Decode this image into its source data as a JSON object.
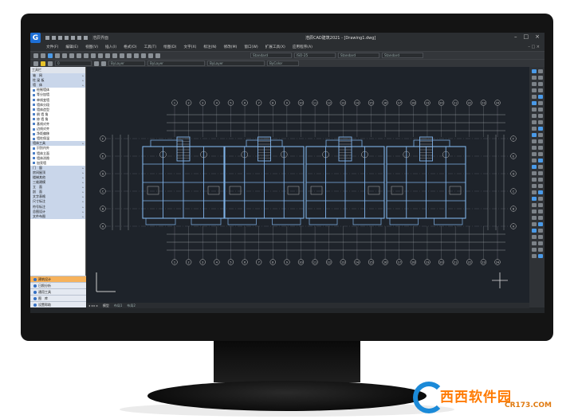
{
  "app": {
    "title": "浩辰CAD建筑2021 - [Drawing1.dwg]",
    "workspace": "浩辰界面"
  },
  "menubar": {
    "items": [
      "文件(F)",
      "编辑(E)",
      "视图(V)",
      "插入(I)",
      "格式(O)",
      "工具(T)",
      "绘图(D)",
      "文字(X)",
      "标注(N)",
      "修改(M)",
      "窗口(W)",
      "扩展工具(X)",
      "帮助(H)",
      "应用程序(A)",
      "帮助(H)"
    ]
  },
  "toolbar": {
    "style_combo": "Standard",
    "dim_combo": "ISO-25",
    "text_combo": "Standard",
    "table_combo": "Standard",
    "layer_combo": "0",
    "color_combo": "ByLayer",
    "linetype_combo": "ByLayer",
    "lineweight_combo": "ByLayer",
    "plot_combo": "ByColor"
  },
  "leftpanel": {
    "header": "工具栏",
    "items": [
      {
        "label": "轴　网",
        "type": "hdr"
      },
      {
        "label": "柱 梁 板",
        "type": "hdr"
      },
      {
        "label": "墙　体",
        "type": "hdr"
      },
      {
        "label": "绘制墙体",
        "type": "sub"
      },
      {
        "label": "等分加墙",
        "type": "sub"
      },
      {
        "label": "单线变墙",
        "type": "sub"
      },
      {
        "label": "墙体分段",
        "type": "sub"
      },
      {
        "label": "墙体造型",
        "type": "sub"
      },
      {
        "label": "倒 墙 角",
        "type": "sub"
      },
      {
        "label": "修 墙 角",
        "type": "sub"
      },
      {
        "label": "基线对齐",
        "type": "sub"
      },
      {
        "label": "边线对齐",
        "type": "sub"
      },
      {
        "label": "净距偏移",
        "type": "sub"
      },
      {
        "label": "墙柱保温",
        "type": "sub"
      },
      {
        "label": "墙体工具",
        "type": "hdr"
      },
      {
        "label": "识别内外",
        "type": "sub"
      },
      {
        "label": "墙体立面",
        "type": "sub"
      },
      {
        "label": "墙体消隐",
        "type": "sub"
      },
      {
        "label": "加亮墙",
        "type": "sub"
      },
      {
        "label": "门　窗",
        "type": "hdr"
      },
      {
        "label": "房间屋顶",
        "type": "hdr"
      },
      {
        "label": "楼梯其他",
        "type": "hdr"
      },
      {
        "label": "三维建模",
        "type": "hdr"
      },
      {
        "label": "立　面",
        "type": "hdr"
      },
      {
        "label": "剖　面",
        "type": "hdr"
      },
      {
        "label": "文字表格",
        "type": "hdr"
      },
      {
        "label": "尺寸标注",
        "type": "hdr"
      },
      {
        "label": "符号标注",
        "type": "hdr"
      },
      {
        "label": "总图设计",
        "type": "hdr"
      },
      {
        "label": "文件布图",
        "type": "hdr"
      }
    ],
    "tabs": [
      {
        "label": "建筑设计",
        "active": true
      },
      {
        "label": "日照分析",
        "active": false
      },
      {
        "label": "通用工具",
        "active": false
      },
      {
        "label": "图　库",
        "active": false
      },
      {
        "label": "设置帮助",
        "active": false
      }
    ]
  },
  "statusbar": {
    "nav": "◂ ◂ ▸ ▸",
    "layouts": [
      "模型",
      "布局1",
      "布局2"
    ]
  },
  "axis_labels": {
    "top": [
      "1",
      "2",
      "3",
      "4",
      "5",
      "6",
      "7",
      "8",
      "9",
      "10",
      "11",
      "12",
      "13",
      "14",
      "15",
      "16",
      "17",
      "18",
      "19",
      "20",
      "21",
      "22",
      "23",
      "24"
    ],
    "left": [
      "F",
      "E",
      "D",
      "C",
      "B",
      "A"
    ]
  },
  "watermark": {
    "brand": "西西软件园",
    "url": "CR173.COM"
  },
  "colors": {
    "canvas": "#1e232a",
    "walls": "#7fb2e8",
    "axis": "#c8c8c8",
    "accent_tab": "#f6b25c",
    "watermark_orange": "#ff7a00",
    "watermark_blue": "#1b8ad8"
  }
}
